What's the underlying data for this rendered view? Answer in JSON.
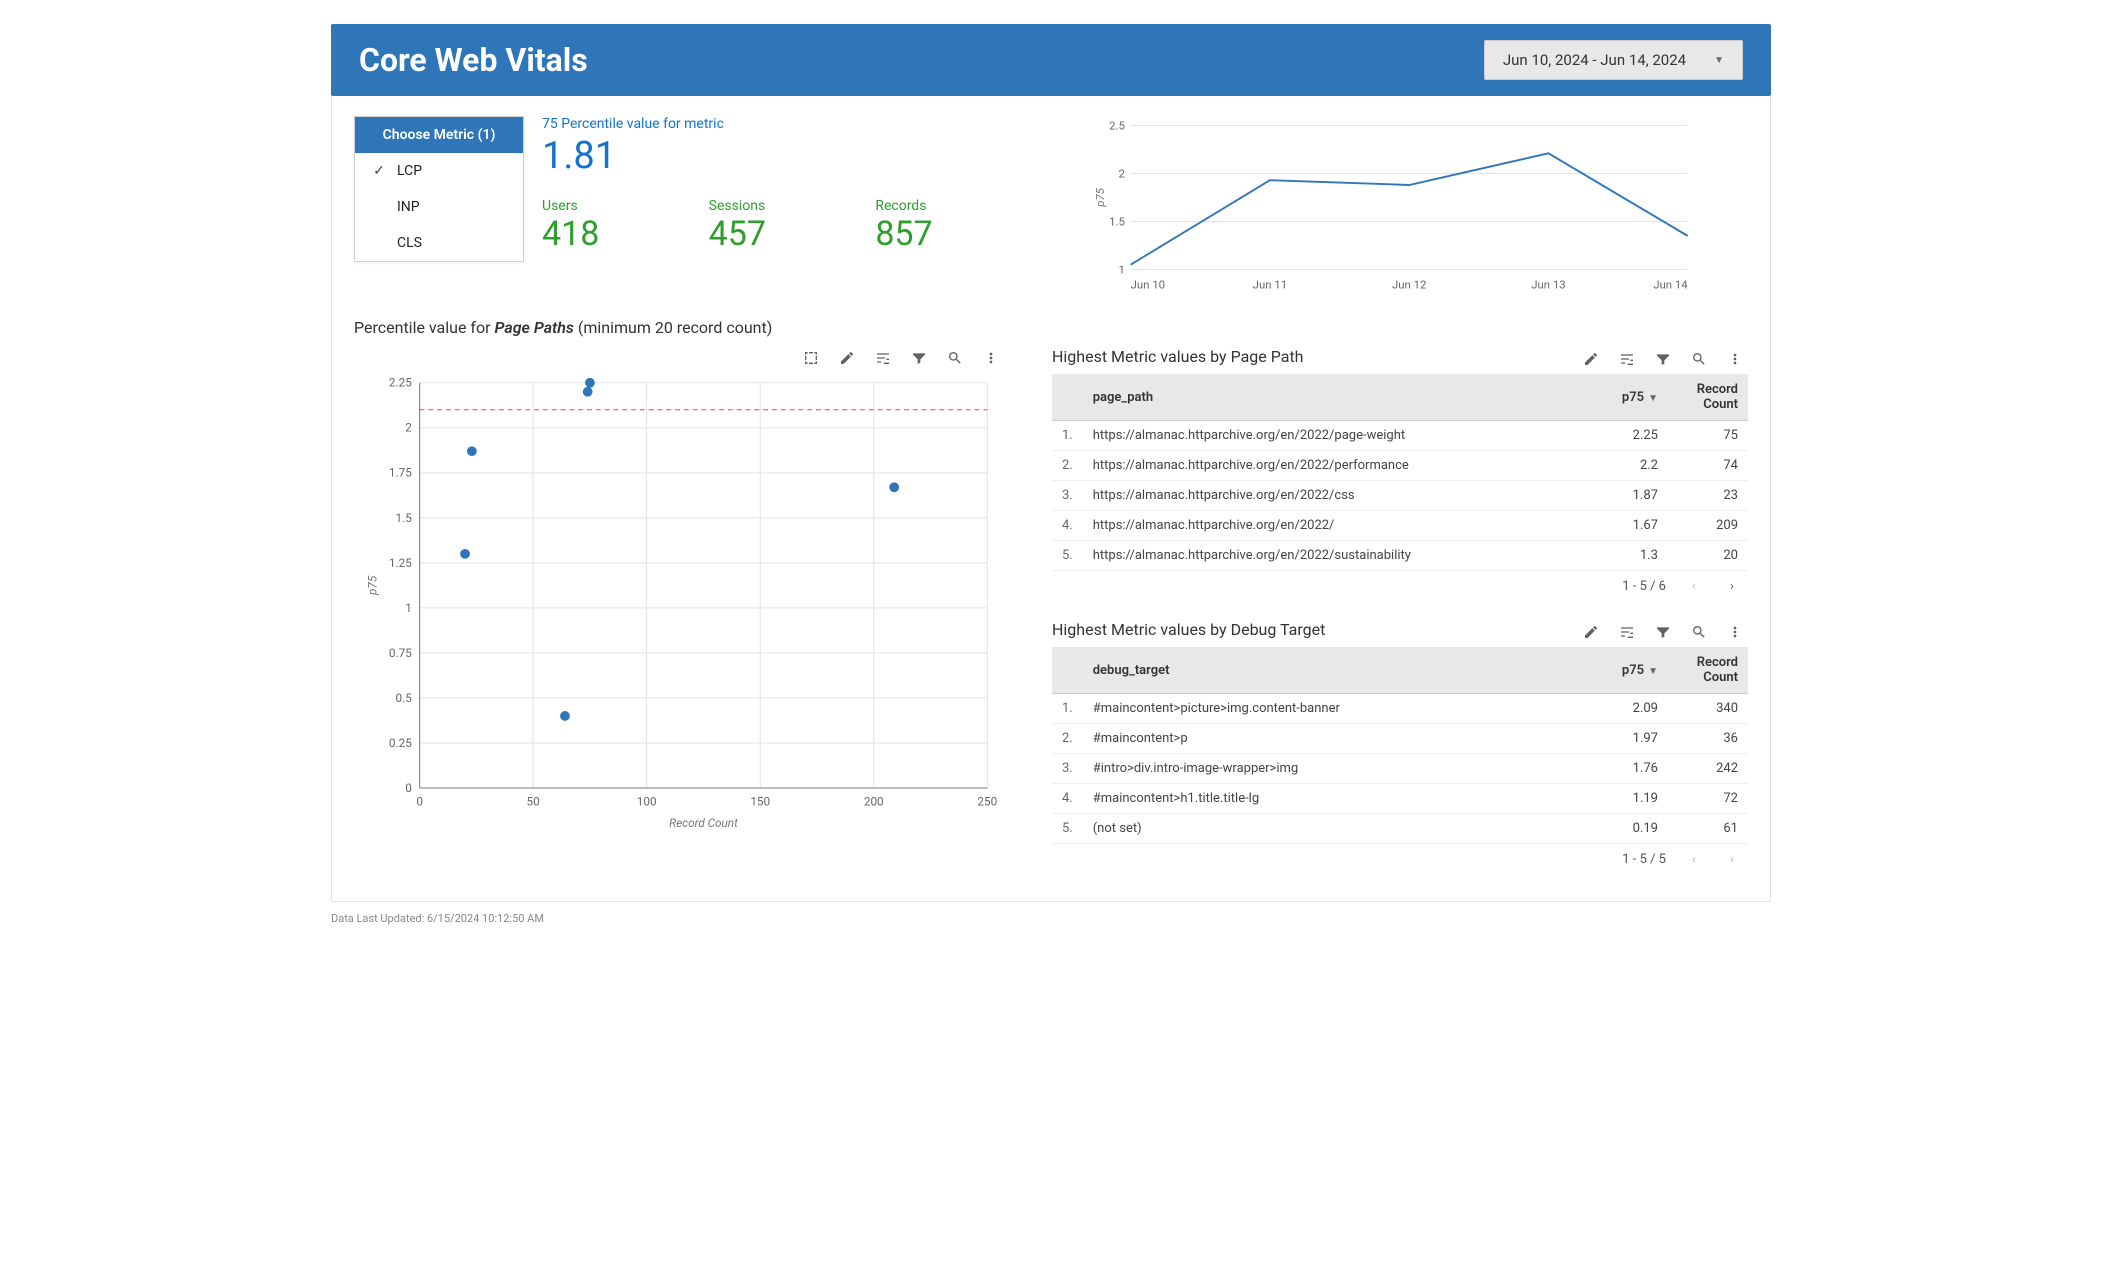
{
  "header": {
    "title": "Core Web Vitals",
    "date_range": "Jun 10, 2024 - Jun 14, 2024"
  },
  "metric_card": {
    "header": "Choose Metric (1)",
    "items": [
      {
        "label": "LCP",
        "checked": true
      },
      {
        "label": "INP",
        "checked": false
      },
      {
        "label": "CLS",
        "checked": false
      }
    ]
  },
  "kpi": {
    "percentile_label": "75 Percentile value for metric",
    "percentile_value": "1.81",
    "users_label": "Users",
    "users_value": "418",
    "sessions_label": "Sessions",
    "sessions_value": "457",
    "records_label": "Records",
    "records_value": "857"
  },
  "section_pagepaths": {
    "prefix": "Percentile value for ",
    "emph": "Page Paths",
    "suffix": " (minimum 20 record count)"
  },
  "chart_data": [
    {
      "id": "trend_line",
      "type": "line",
      "ylabel": "p75",
      "ylim": [
        1,
        2.5
      ],
      "categories": [
        "Jun 10",
        "Jun 11",
        "Jun 12",
        "Jun 13",
        "Jun 14"
      ],
      "values": [
        1.05,
        1.93,
        1.88,
        2.21,
        1.35
      ]
    },
    {
      "id": "pagepath_scatter",
      "type": "scatter",
      "xlabel": "Record Count",
      "ylabel": "p75",
      "xlim": [
        0,
        250
      ],
      "ylim": [
        0,
        2.25
      ],
      "reference_line_y": 2.1,
      "points": [
        {
          "x": 75,
          "y": 2.25
        },
        {
          "x": 74,
          "y": 2.2
        },
        {
          "x": 23,
          "y": 1.87
        },
        {
          "x": 209,
          "y": 1.67
        },
        {
          "x": 20,
          "y": 1.3
        },
        {
          "x": 64,
          "y": 0.4
        }
      ]
    }
  ],
  "table_pagepath": {
    "title": "Highest Metric values by Page Path",
    "col_path": "page_path",
    "col_p75": "p75",
    "col_count": "Record Count",
    "rows": [
      {
        "idx": "1.",
        "path": "https://almanac.httparchive.org/en/2022/page-weight",
        "p75": "2.25",
        "count": "75"
      },
      {
        "idx": "2.",
        "path": "https://almanac.httparchive.org/en/2022/performance",
        "p75": "2.2",
        "count": "74"
      },
      {
        "idx": "3.",
        "path": "https://almanac.httparchive.org/en/2022/css",
        "p75": "1.87",
        "count": "23"
      },
      {
        "idx": "4.",
        "path": "https://almanac.httparchive.org/en/2022/",
        "p75": "1.67",
        "count": "209"
      },
      {
        "idx": "5.",
        "path": "https://almanac.httparchive.org/en/2022/sustainability",
        "p75": "1.3",
        "count": "20"
      }
    ],
    "pager": "1 - 5 / 6"
  },
  "table_debug": {
    "title": "Highest Metric values by Debug Target",
    "col_target": "debug_target",
    "col_p75": "p75",
    "col_count": "Record Count",
    "rows": [
      {
        "idx": "1.",
        "target": "#maincontent>picture>img.content-banner",
        "p75": "2.09",
        "count": "340"
      },
      {
        "idx": "2.",
        "target": "#maincontent>p",
        "p75": "1.97",
        "count": "36"
      },
      {
        "idx": "3.",
        "target": "#intro>div.intro-image-wrapper>img",
        "p75": "1.76",
        "count": "242"
      },
      {
        "idx": "4.",
        "target": "#maincontent>h1.title.title-lg",
        "p75": "1.19",
        "count": "72"
      },
      {
        "idx": "5.",
        "target": "(not set)",
        "p75": "0.19",
        "count": "61"
      }
    ],
    "pager": "1 - 5 / 5"
  },
  "footer": {
    "text": "Data Last Updated: 6/15/2024 10:12:50 AM"
  },
  "icons": {
    "select": "select-box-icon",
    "pencil": "pencil-icon",
    "sliders": "sliders-icon",
    "filter": "filter-icon",
    "zoom": "zoom-icon",
    "more": "more-vert-icon",
    "sort": "▼",
    "prev": "‹",
    "next": "›",
    "caret": "▼",
    "check": "✓"
  }
}
